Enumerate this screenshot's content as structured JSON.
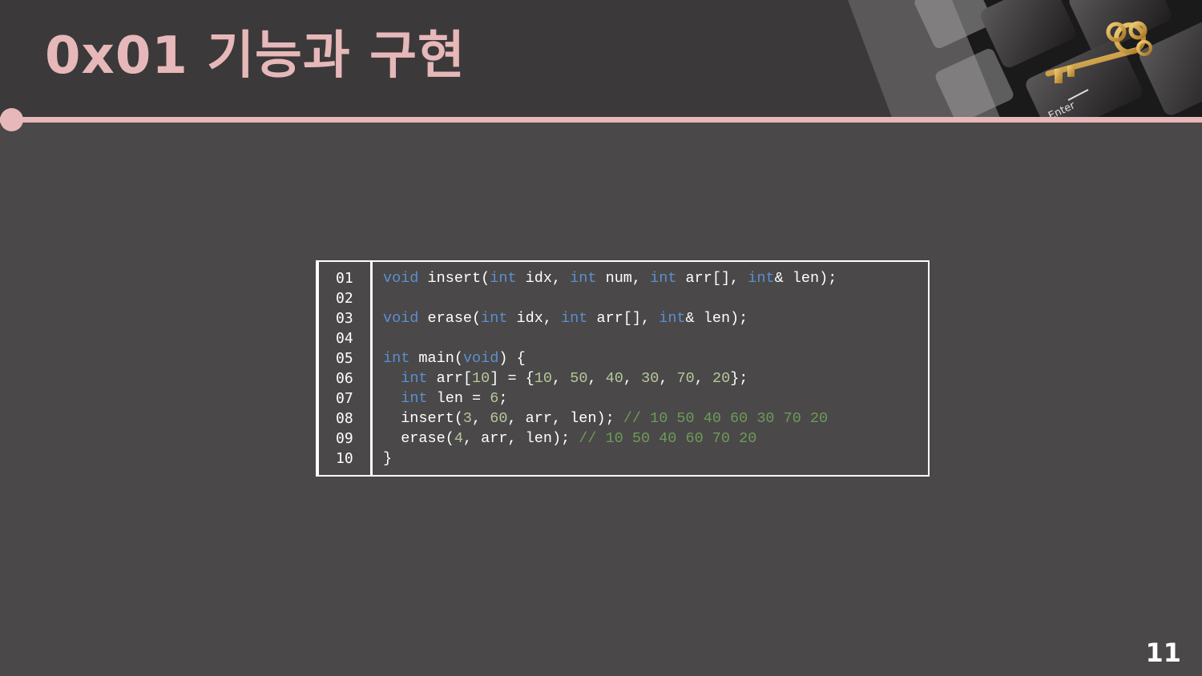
{
  "slide": {
    "title": "0x01  기능과 구현",
    "page_number": "11"
  },
  "colors": {
    "accent": "#e7b8b9",
    "background": "#4a4849",
    "header_background": "#3c393a",
    "keyword": "#5b8fd0",
    "number": "#b5c99a",
    "comment": "#6f9a58"
  },
  "code": {
    "line_numbers": [
      "01",
      "02",
      "03",
      "04",
      "05",
      "06",
      "07",
      "08",
      "09",
      "10"
    ],
    "lines": [
      [
        {
          "t": "kw",
          "s": "void"
        },
        {
          "t": "tx",
          "s": " insert("
        },
        {
          "t": "kw",
          "s": "int"
        },
        {
          "t": "tx",
          "s": " idx, "
        },
        {
          "t": "kw",
          "s": "int"
        },
        {
          "t": "tx",
          "s": " num, "
        },
        {
          "t": "kw",
          "s": "int"
        },
        {
          "t": "tx",
          "s": " arr[], "
        },
        {
          "t": "kw",
          "s": "int"
        },
        {
          "t": "tx",
          "s": "& len);"
        }
      ],
      [],
      [
        {
          "t": "kw",
          "s": "void"
        },
        {
          "t": "tx",
          "s": " erase("
        },
        {
          "t": "kw",
          "s": "int"
        },
        {
          "t": "tx",
          "s": " idx, "
        },
        {
          "t": "kw",
          "s": "int"
        },
        {
          "t": "tx",
          "s": " arr[], "
        },
        {
          "t": "kw",
          "s": "int"
        },
        {
          "t": "tx",
          "s": "& len);"
        }
      ],
      [],
      [
        {
          "t": "kw",
          "s": "int"
        },
        {
          "t": "tx",
          "s": " main("
        },
        {
          "t": "kw",
          "s": "void"
        },
        {
          "t": "tx",
          "s": ") {"
        }
      ],
      [
        {
          "t": "tx",
          "s": "  "
        },
        {
          "t": "kw",
          "s": "int"
        },
        {
          "t": "tx",
          "s": " arr["
        },
        {
          "t": "num",
          "s": "10"
        },
        {
          "t": "tx",
          "s": "] = {"
        },
        {
          "t": "num",
          "s": "10"
        },
        {
          "t": "tx",
          "s": ", "
        },
        {
          "t": "num",
          "s": "50"
        },
        {
          "t": "tx",
          "s": ", "
        },
        {
          "t": "num",
          "s": "40"
        },
        {
          "t": "tx",
          "s": ", "
        },
        {
          "t": "num",
          "s": "30"
        },
        {
          "t": "tx",
          "s": ", "
        },
        {
          "t": "num",
          "s": "70"
        },
        {
          "t": "tx",
          "s": ", "
        },
        {
          "t": "num",
          "s": "20"
        },
        {
          "t": "tx",
          "s": "};"
        }
      ],
      [
        {
          "t": "tx",
          "s": "  "
        },
        {
          "t": "kw",
          "s": "int"
        },
        {
          "t": "tx",
          "s": " len = "
        },
        {
          "t": "num",
          "s": "6"
        },
        {
          "t": "tx",
          "s": ";"
        }
      ],
      [
        {
          "t": "tx",
          "s": "  insert("
        },
        {
          "t": "num",
          "s": "3"
        },
        {
          "t": "tx",
          "s": ", "
        },
        {
          "t": "num",
          "s": "60"
        },
        {
          "t": "tx",
          "s": ", arr, len); "
        },
        {
          "t": "cm",
          "s": "// 10 50 40 60 30 70 20"
        }
      ],
      [
        {
          "t": "tx",
          "s": "  erase("
        },
        {
          "t": "num",
          "s": "4"
        },
        {
          "t": "tx",
          "s": ", arr, len); "
        },
        {
          "t": "cm",
          "s": "// 10 50 40 60 70 20"
        }
      ],
      [
        {
          "t": "tx",
          "s": "}"
        }
      ]
    ]
  },
  "decor": {
    "keyboard_image": "keyboard-key-photo",
    "key_label": "Enter"
  }
}
